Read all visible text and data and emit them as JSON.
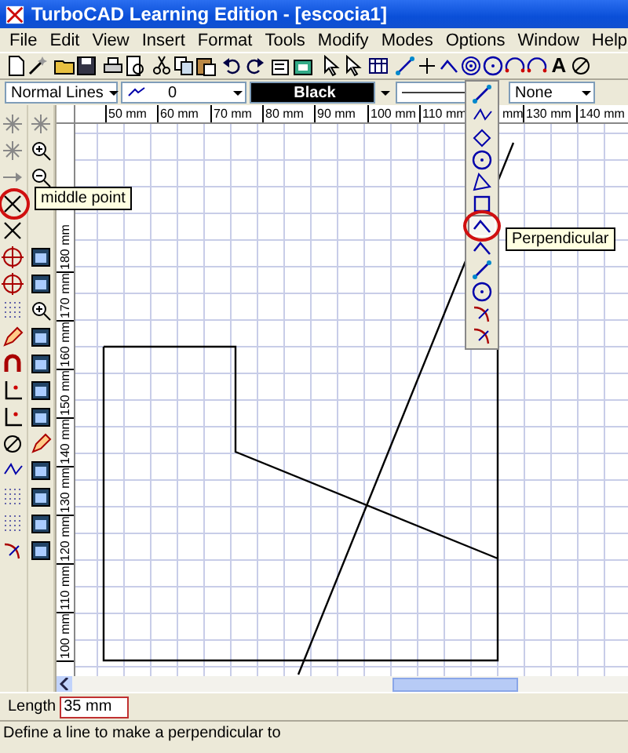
{
  "window": {
    "title": "TurboCAD Learning Edition - [escocia1]"
  },
  "menu": [
    "File",
    "Edit",
    "View",
    "Insert",
    "Format",
    "Tools",
    "Modify",
    "Modes",
    "Options",
    "Window",
    "Help"
  ],
  "toolbar": {
    "text_tool": "A"
  },
  "property_bar": {
    "line_style": "Normal Lines",
    "layer": "0",
    "pen_color_name": "Black",
    "fill": "None"
  },
  "rulers": {
    "horizontal": [
      {
        "text": "50 mm",
        "partial": false
      },
      {
        "text": "60 mm",
        "partial": false
      },
      {
        "text": "70 mm",
        "partial": false
      },
      {
        "text": "80 mm",
        "partial": false
      },
      {
        "text": "90 mm",
        "partial": false
      },
      {
        "text": "100 mm",
        "partial": false
      },
      {
        "text": "110 mm",
        "partial": false
      },
      {
        "text": "mm",
        "partial": true
      },
      {
        "text": "130 mm",
        "partial": false
      },
      {
        "text": "140 mm",
        "partial": false
      }
    ],
    "vertical": [
      "180 mm",
      "170 mm",
      "160 mm",
      "150 mm",
      "140 mm",
      "130 mm",
      "120 mm",
      "110 mm",
      "100 mm"
    ]
  },
  "left_tools": [
    {
      "circled": false
    },
    {
      "circled": false
    },
    {
      "circled": false
    },
    {
      "circled": true
    },
    {
      "circled": false
    },
    {
      "circled": false
    },
    {
      "circled": false
    },
    {
      "circled": false
    },
    {
      "circled": false
    },
    {
      "circled": false
    },
    {
      "circled": false
    },
    {
      "circled": false
    },
    {
      "circled": false
    },
    {
      "circled": false
    },
    {
      "circled": false
    },
    {
      "circled": false
    },
    {
      "circled": false
    }
  ],
  "flyout": [
    {
      "selected": false,
      "circled": false
    },
    {
      "selected": false,
      "circled": false
    },
    {
      "selected": false,
      "circled": false
    },
    {
      "selected": false,
      "circled": false
    },
    {
      "selected": false,
      "circled": false
    },
    {
      "selected": false,
      "circled": false
    },
    {
      "selected": true,
      "circled": true
    },
    {
      "selected": false,
      "circled": false
    },
    {
      "selected": false,
      "circled": false
    },
    {
      "selected": false,
      "circled": false
    },
    {
      "selected": false,
      "circled": false
    },
    {
      "selected": false,
      "circled": false
    }
  ],
  "tooltips": [
    "middle point",
    "Perpendicular"
  ],
  "inspector": {
    "label": "Length",
    "value": "35 mm"
  },
  "status_bar": "Define a line to make a perpendicular to"
}
